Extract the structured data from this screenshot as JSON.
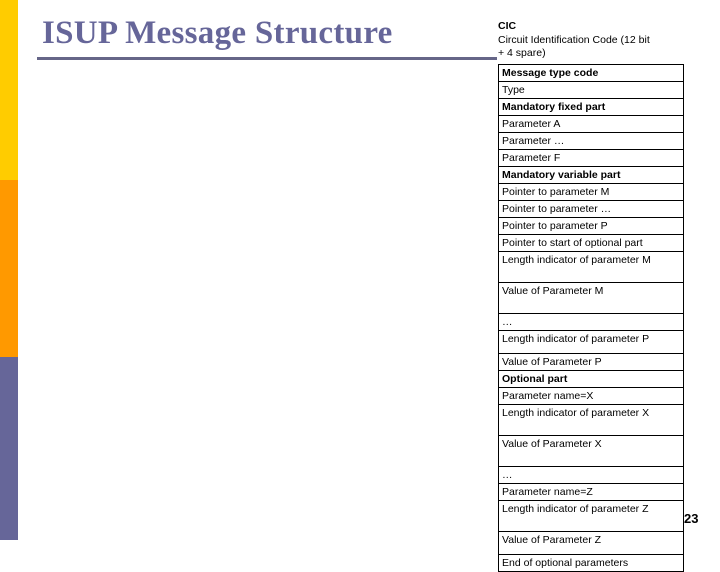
{
  "slide": {
    "title": "ISUP Message Structure",
    "page_number": "23",
    "accent_colors": {
      "title": "#666699",
      "rule": "#666688",
      "band_top": "#ffcc00",
      "band_middle": "#ff9900",
      "band_bottom": "#666699"
    }
  },
  "structure": {
    "caption": {
      "heading": "CIC",
      "line1": "Circuit Identification Code (12 bit",
      "line2": "+ 4 spare)"
    },
    "rows": [
      {
        "label": "Message type code",
        "bold": true,
        "size": "normal"
      },
      {
        "label": "Type",
        "bold": false,
        "size": "normal"
      },
      {
        "label": "Mandatory fixed part",
        "bold": true,
        "size": "normal"
      },
      {
        "label": "Parameter A",
        "bold": false,
        "size": "normal"
      },
      {
        "label": "Parameter …",
        "bold": false,
        "size": "normal"
      },
      {
        "label": "Parameter F",
        "bold": false,
        "size": "normal"
      },
      {
        "label": "Mandatory variable part",
        "bold": true,
        "size": "normal"
      },
      {
        "label": "Pointer to parameter M",
        "bold": false,
        "size": "normal"
      },
      {
        "label": "Pointer to parameter …",
        "bold": false,
        "size": "normal"
      },
      {
        "label": "Pointer to parameter P",
        "bold": false,
        "size": "normal"
      },
      {
        "label": "Pointer to start of optional part",
        "bold": false,
        "size": "normal"
      },
      {
        "label": "Length indicator of parameter M",
        "bold": false,
        "size": "tall"
      },
      {
        "label": "Value of Parameter M",
        "bold": false,
        "size": "tall"
      },
      {
        "label": "…",
        "bold": false,
        "size": "normal"
      },
      {
        "label": "Length indicator of parameter P",
        "bold": false,
        "size": "tall-sm"
      },
      {
        "label": "Value of Parameter P",
        "bold": false,
        "size": "normal"
      },
      {
        "label": "Optional part",
        "bold": true,
        "size": "normal"
      },
      {
        "label": "Parameter name=X",
        "bold": false,
        "size": "normal"
      },
      {
        "label": "Length indicator of parameter X",
        "bold": false,
        "size": "tall"
      },
      {
        "label": "Value of Parameter X",
        "bold": false,
        "size": "tall"
      },
      {
        "label": "…",
        "bold": false,
        "size": "normal"
      },
      {
        "label": "Parameter name=Z",
        "bold": false,
        "size": "normal"
      },
      {
        "label": "Length indicator of parameter Z",
        "bold": false,
        "size": "tall"
      },
      {
        "label": "Value of Parameter Z",
        "bold": false,
        "size": "tall-sm"
      },
      {
        "label": "End of optional parameters",
        "bold": false,
        "size": "normal"
      }
    ]
  }
}
